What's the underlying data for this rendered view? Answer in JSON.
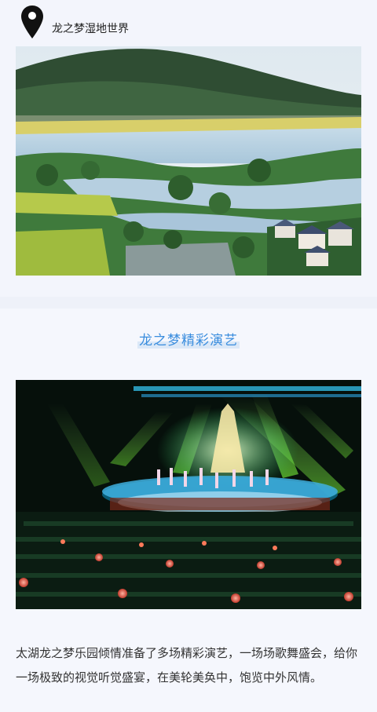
{
  "location": {
    "icon": "map-pin-icon",
    "label": "龙之梦湿地世界"
  },
  "landscape_photo": {
    "subject": "wetland-aerial-photo"
  },
  "section": {
    "title": "龙之梦精彩演艺"
  },
  "show_photo": {
    "subject": "stage-performance-photo"
  },
  "description": "太湖龙之梦乐园倾情准备了多场精彩演艺，一场场歌舞盛会，给你一场极致的视觉听觉盛宴，在美轮美奂中，饱览中外风情。",
  "colors": {
    "accent": "#3a8dde",
    "page_background": "#eef1f9",
    "text": "#333333"
  }
}
